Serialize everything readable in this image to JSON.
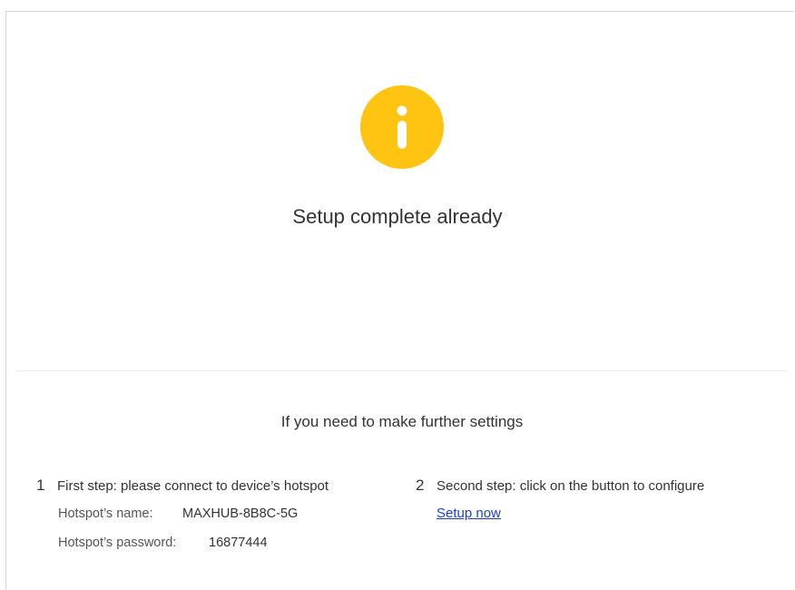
{
  "status": {
    "icon": "info-icon",
    "icon_color": "#FFC412",
    "title": "Setup complete already"
  },
  "further": {
    "title": "If you need to make further settings"
  },
  "steps": [
    {
      "number": "1",
      "text": "First step: please connect to device’s hotspot",
      "fields": [
        {
          "label": "Hotspot’s name:",
          "value": "MAXHUB-8B8C-5G"
        },
        {
          "label": "Hotspot’s password:",
          "value": "16877444"
        }
      ]
    },
    {
      "number": "2",
      "text": "Second step: click on the button to configure",
      "link": "Setup now"
    }
  ],
  "colors": {
    "link": "#1a3fd1",
    "divider": "#ebebeb"
  }
}
